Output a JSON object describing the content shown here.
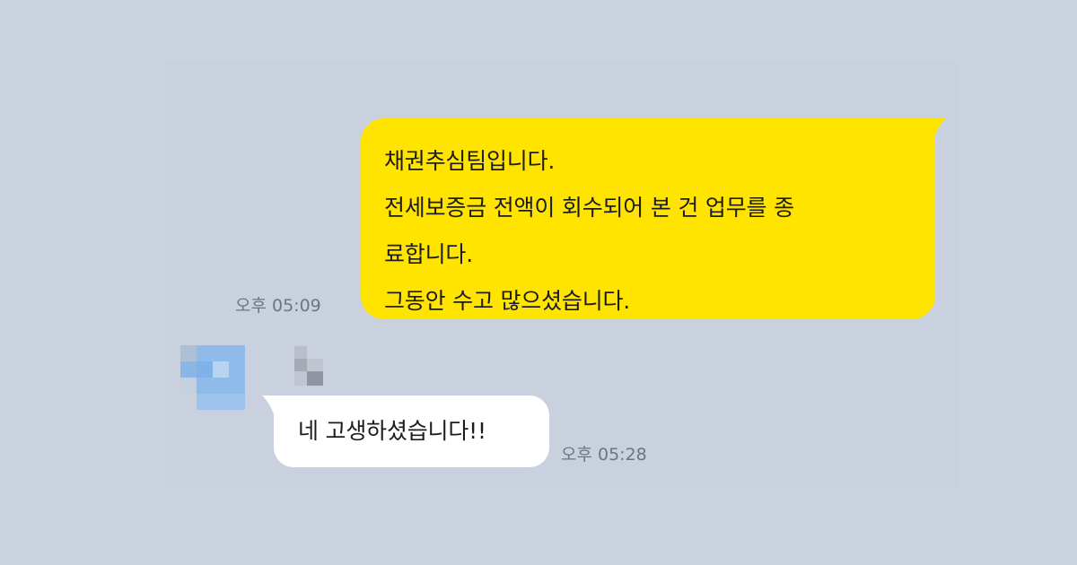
{
  "conversation": {
    "outgoing_message": {
      "lines": [
        "채권추심팀입니다.",
        "전세보증금 전액이 회수되어 본 건 업무를 종",
        "료합니다.",
        "그동안 수고 많으셨습니다."
      ],
      "time": "오후 05:09",
      "bubble_color": "#ffe400"
    },
    "incoming_message": {
      "sender_avatar": "pixelated-avatar",
      "sender_name": "pixelated-name",
      "text": "네 고생하셨습니다!!",
      "time": "오후 05:28",
      "bubble_color": "#ffffff"
    },
    "background_color": "#cbd3df"
  }
}
